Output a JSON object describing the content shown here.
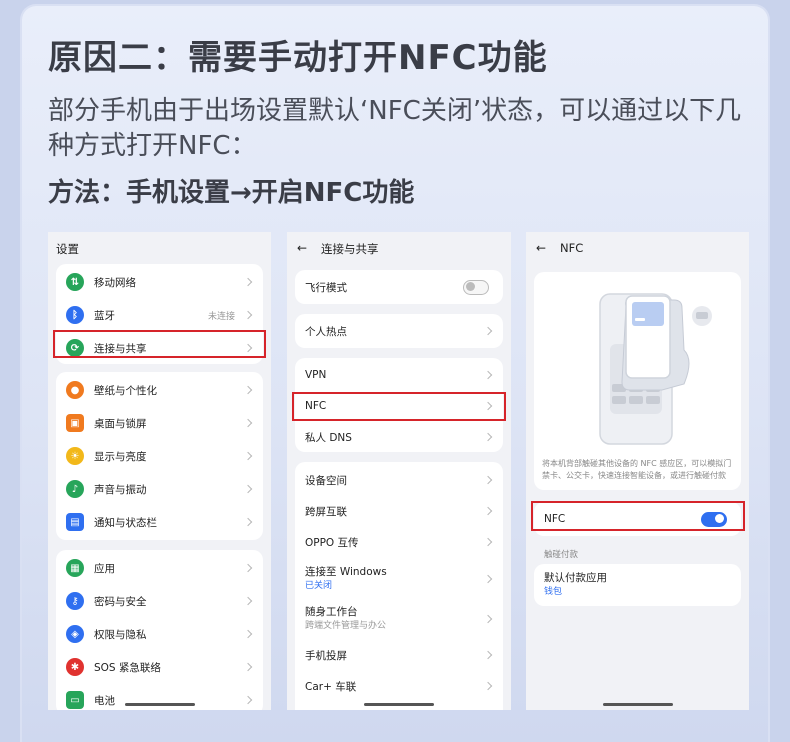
{
  "title": "原因二：需要手动打开NFC功能",
  "description": "部分手机由于出场设置默认‘NFC关闭’状态，可以通过以下几种方式打开NFC：",
  "method": "方法：手机设置→开启NFC功能",
  "screen1": {
    "title": "设置",
    "items": [
      {
        "label": "移动网络",
        "icon": "signal-icon",
        "color": "#27a55a"
      },
      {
        "label": "蓝牙",
        "icon": "bluetooth-icon",
        "color": "#2f6ff0",
        "status": "未连接"
      },
      {
        "label": "连接与共享",
        "icon": "share-icon",
        "color": "#27a55a"
      },
      {
        "label": "壁纸与个性化",
        "icon": "palette-icon",
        "color": "#f07a1f"
      },
      {
        "label": "桌面与锁屏",
        "icon": "desktop-icon",
        "color": "#f07a1f"
      },
      {
        "label": "显示与亮度",
        "icon": "sun-icon",
        "color": "#f2b81a"
      },
      {
        "label": "声音与振动",
        "icon": "bell-icon",
        "color": "#27a55a"
      },
      {
        "label": "通知与状态栏",
        "icon": "notification-icon",
        "color": "#2f6ff0"
      },
      {
        "label": "应用",
        "icon": "apps-icon",
        "color": "#27a55a"
      },
      {
        "label": "密码与安全",
        "icon": "key-icon",
        "color": "#2f6ff0"
      },
      {
        "label": "权限与隐私",
        "icon": "shield-icon",
        "color": "#2f6ff0"
      },
      {
        "label": "SOS 紧急联络",
        "icon": "sos-icon",
        "color": "#e0322f"
      },
      {
        "label": "电池",
        "icon": "battery-icon",
        "color": "#27a55a"
      }
    ]
  },
  "screen2": {
    "title": "连接与共享",
    "airplane": "飞行模式",
    "hotspot": "个人热点",
    "vpn": "VPN",
    "nfc": "NFC",
    "dns": "私人 DNS",
    "device_space": "设备空间",
    "cross_screen": "跨屏互联",
    "oppo": "OPPO 互传",
    "windows": "连接至 Windows",
    "windows_status": "已关闭",
    "workbench": "随身工作台",
    "workbench_sub": "跨端文件管理与办公",
    "cast": "手机投屏",
    "car": "Car+ 车联"
  },
  "screen3": {
    "title": "NFC",
    "info": "将本机背部触碰其他设备的 NFC 感应区，可以模拟门禁卡、公交卡，快速连接智能设备，或进行触碰付款",
    "nfc_label": "NFC",
    "pay_header": "触碰付款",
    "default_pay": "默认付款应用",
    "wallet": "钱包"
  }
}
